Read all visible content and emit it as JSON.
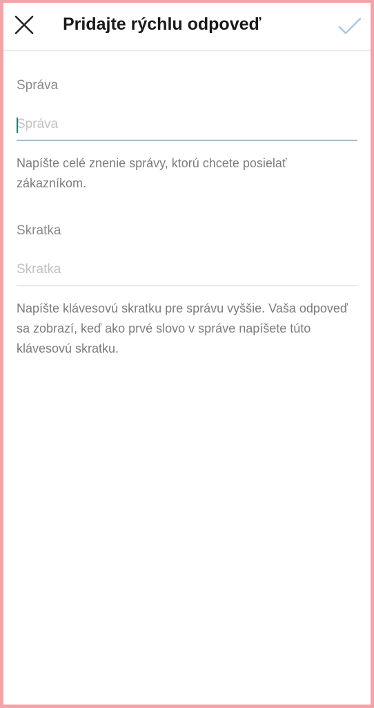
{
  "header": {
    "title": "Pridajte rýchlu odpoveď",
    "close_icon": "close-icon",
    "confirm_icon": "check-icon"
  },
  "message": {
    "label": "Správa",
    "placeholder": "Správa",
    "value": "",
    "helper": "Napíšte celé znenie správy, ktorú chcete posielať zákazníkom."
  },
  "shortcut": {
    "label": "Skratka",
    "placeholder": "Skratka",
    "value": "",
    "helper": "Napíšte klávesovú skratku pre správu vyššie. Vaša odpoveď sa zobrazí, keď ako prvé slovo v správe napíšete túto klávesovú skratku."
  },
  "colors": {
    "page_border": "#f4a3a8",
    "caret": "#1a7b71",
    "active_underline": "#a4bed2",
    "confirm_icon": "#a9c9e6"
  }
}
